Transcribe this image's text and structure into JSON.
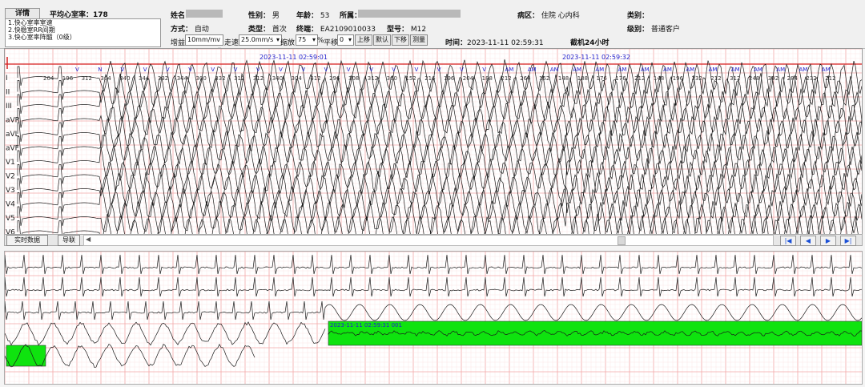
{
  "header": {
    "details_tab": "详情",
    "avg_hr_label": "平均心室率：",
    "avg_hr_value": "178",
    "diagnoses": [
      "1.快心室率室速",
      "2.快稳室RR间期",
      "3.快心室率阵髓（0级）"
    ],
    "name_label": "姓名：",
    "gender_label": "性别：",
    "gender_value": "男",
    "age_label": "年龄：",
    "age_value": "53",
    "hospital_label": "所属：",
    "ward_label": "病区：",
    "ward_value": "住院  心内科",
    "category_label": "类别：",
    "method_label": "方式：",
    "method_value": "自动",
    "type_label": "类型：",
    "type_value": "首次",
    "terminal_label": "终端：",
    "terminal_value": "EA2109010033",
    "model_label": "型号：",
    "model_value": "M12",
    "level_label": "级别：",
    "level_value": "普通客户",
    "gain_label": "增益",
    "gain_value": "10mm/mv",
    "speed_label": "走速",
    "speed_value": "25.0mm/s",
    "zoom_label": "缩放",
    "zoom_value": "75",
    "zoom_unit": "%",
    "shift_label": "平移",
    "shift_value": "0",
    "btn_up": "上移",
    "btn_default": "默认",
    "btn_down": "下移",
    "btn_measure": "测量",
    "time_label": "时间：",
    "time_value": "2023-11-11  02:59:31",
    "device_label": "截机24小时"
  },
  "ecg_top": {
    "leads": [
      "I",
      "II",
      "III",
      "aVR",
      "aVL",
      "aVF",
      "V1",
      "V2",
      "V3",
      "V4",
      "V5",
      "V6"
    ],
    "stamp_left": "2023-11-11  02:59:01",
    "stamp_right": "2023-11-11  02:59:32",
    "beat_labels": [
      "V",
      "N",
      "V",
      "V",
      "V",
      "V",
      "V",
      "V",
      "V",
      "V",
      "V",
      "V",
      "V",
      "V",
      "V",
      "V",
      "V",
      "V",
      "V",
      "AM",
      "AM",
      "AM",
      "AM",
      "AM",
      "AM",
      "AM",
      "AM",
      "AM",
      "AM",
      "AM",
      "AM",
      "AM",
      "AM",
      "AM"
    ],
    "rr_values": [
      "204",
      "196",
      "312",
      "304",
      "340",
      "344",
      "332",
      "344",
      "300",
      "332",
      "312",
      "312",
      "340",
      "304",
      "412",
      "296",
      "308",
      "312",
      "360",
      "152",
      "216",
      "196",
      "204",
      "188",
      "212",
      "264",
      "152",
      "148",
      "188",
      "176",
      "176",
      "212",
      "148",
      "196",
      "232",
      "212",
      "312",
      "248",
      "392",
      "284",
      "232",
      "212"
    ]
  },
  "mid_bar": {
    "btn_realtime": "实时数据",
    "btn_navigate": "导联"
  },
  "ecg_bottom": {
    "stamp": "2023-11-11  02:59:31  001"
  },
  "colors": {
    "grid_major": "#f3a7a7",
    "grid_minor": "#fbe1e1",
    "baseline": "#d62020",
    "highlight": "#0fe30f",
    "trace": "#1a1a1a",
    "stamp": "#2222cc"
  }
}
